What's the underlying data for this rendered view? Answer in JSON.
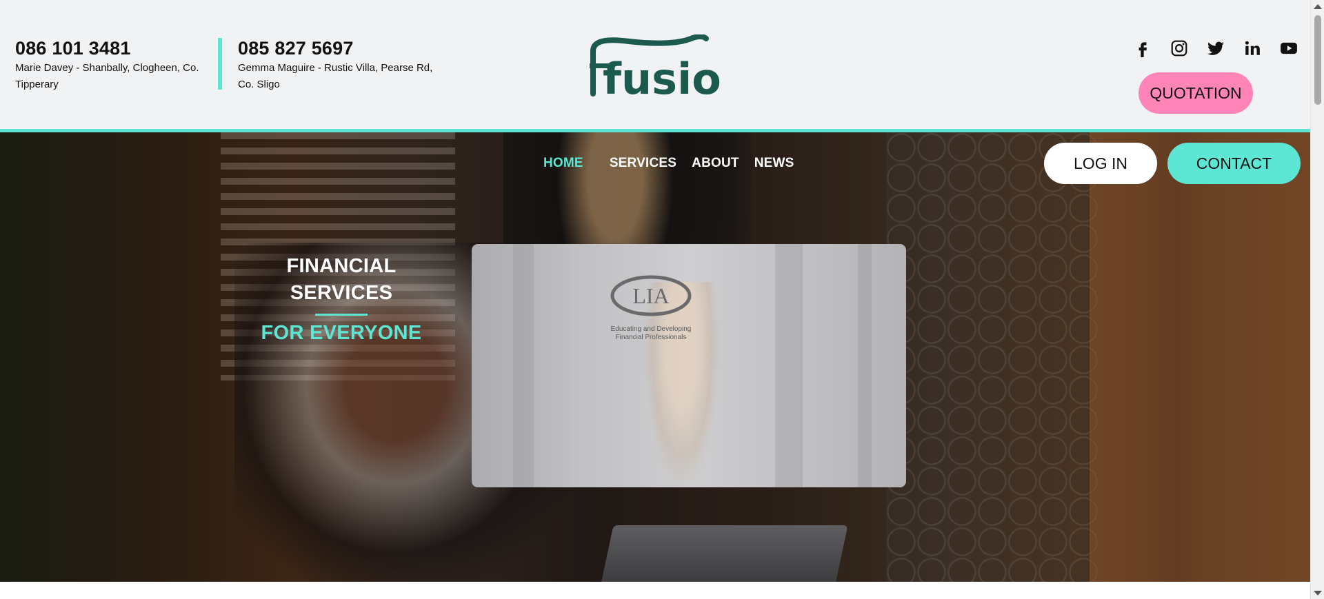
{
  "contacts": [
    {
      "phone": "086 101 3481",
      "address": "Marie Davey - Shanbally, Clogheen, Co. Tipperary"
    },
    {
      "phone": "085 827 5697",
      "address": "Gemma Maguire - Rustic Villa, Pearse Rd, Co. Sligo"
    }
  ],
  "brand": {
    "logo_text": "fusion",
    "logo_color": "#1c5a4e"
  },
  "socials": [
    "facebook-icon",
    "instagram-icon",
    "twitter-icon",
    "linkedin-icon",
    "youtube-icon"
  ],
  "header": {
    "quotation_label": "QUOTATION"
  },
  "nav": {
    "items": [
      {
        "label": "HOME",
        "active": true
      },
      {
        "label": "SERVICES",
        "active": false
      },
      {
        "label": "ABOUT",
        "active": false
      },
      {
        "label": "NEWS",
        "active": false
      }
    ],
    "login_label": "LOG IN",
    "contact_label": "CONTACT"
  },
  "hero": {
    "tagline_line1": "FINANCIAL",
    "tagline_line2": "SERVICES",
    "tagline_line3": "FOR EVERYONE"
  },
  "lia": {
    "logo_text": "LIA",
    "subtitle_line1": "Educating and Developing",
    "subtitle_line2": "Financial Professionals"
  },
  "colors": {
    "accent_teal": "#5ee6d4",
    "accent_pink": "#ff85b8",
    "header_bg": "#f1f2f4",
    "logo_green": "#1c5a4e"
  }
}
